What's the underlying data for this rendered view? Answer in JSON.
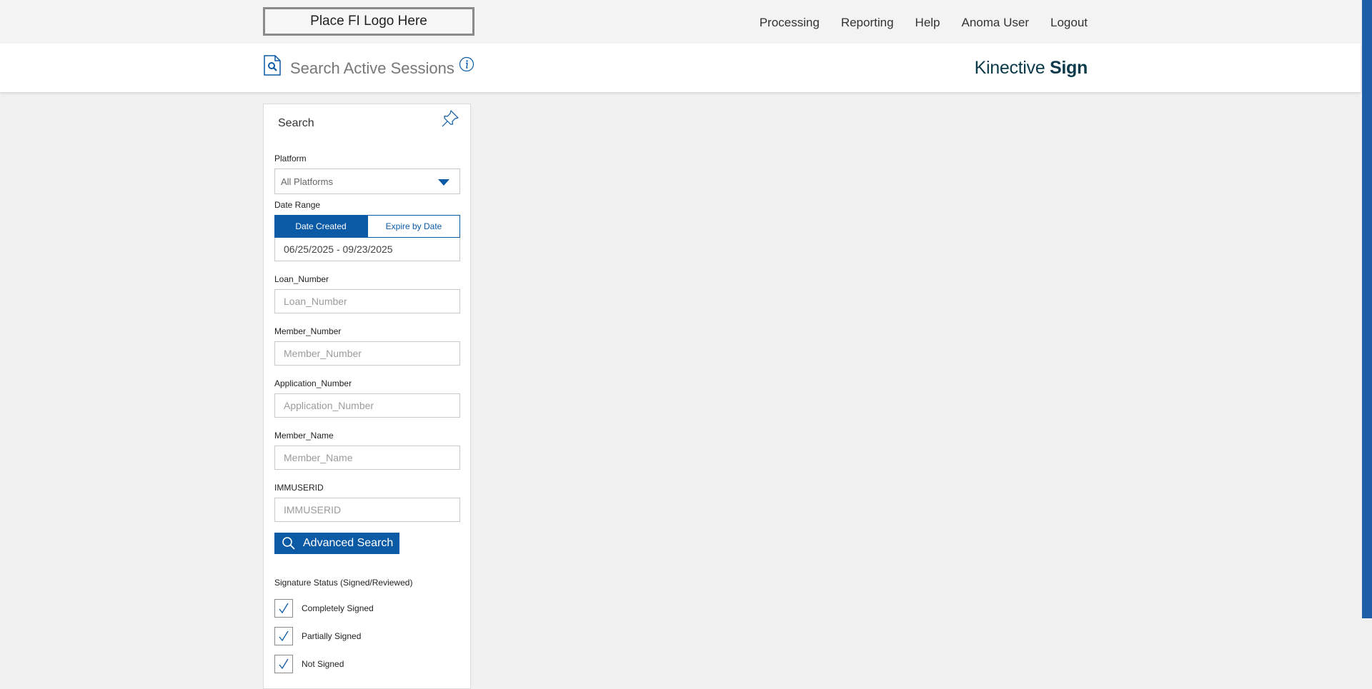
{
  "header": {
    "logo_text": "Place FI Logo Here",
    "nav": [
      "Processing",
      "Reporting",
      "Help",
      "Anoma User",
      "Logout"
    ]
  },
  "subheader": {
    "title": "Search Active Sessions",
    "brand_light": "Kinective",
    "brand_bold": "Sign"
  },
  "search_panel": {
    "title": "Search",
    "platform": {
      "label": "Platform",
      "value": "All Platforms"
    },
    "date_range": {
      "label": "Date Range",
      "options": [
        "Date Created",
        "Expire by Date"
      ],
      "selected": "Date Created",
      "value": "06/25/2025 - 09/23/2025"
    },
    "fields": [
      {
        "label": "Loan_Number",
        "placeholder": "Loan_Number"
      },
      {
        "label": "Member_Number",
        "placeholder": "Member_Number"
      },
      {
        "label": "Application_Number",
        "placeholder": "Application_Number"
      },
      {
        "label": "Member_Name",
        "placeholder": "Member_Name"
      },
      {
        "label": "IMMUSERID",
        "placeholder": "IMMUSERID"
      }
    ],
    "advanced_search_label": "Advanced Search",
    "signature_status": {
      "label": "Signature Status (Signed/Reviewed)",
      "options": [
        {
          "label": "Completely Signed",
          "checked": true
        },
        {
          "label": "Partially Signed",
          "checked": true
        },
        {
          "label": "Not Signed",
          "checked": true
        }
      ]
    }
  },
  "colors": {
    "accent": "#0b5aa6",
    "brand_text": "#0c3a4a",
    "background": "#f0f0f0"
  }
}
